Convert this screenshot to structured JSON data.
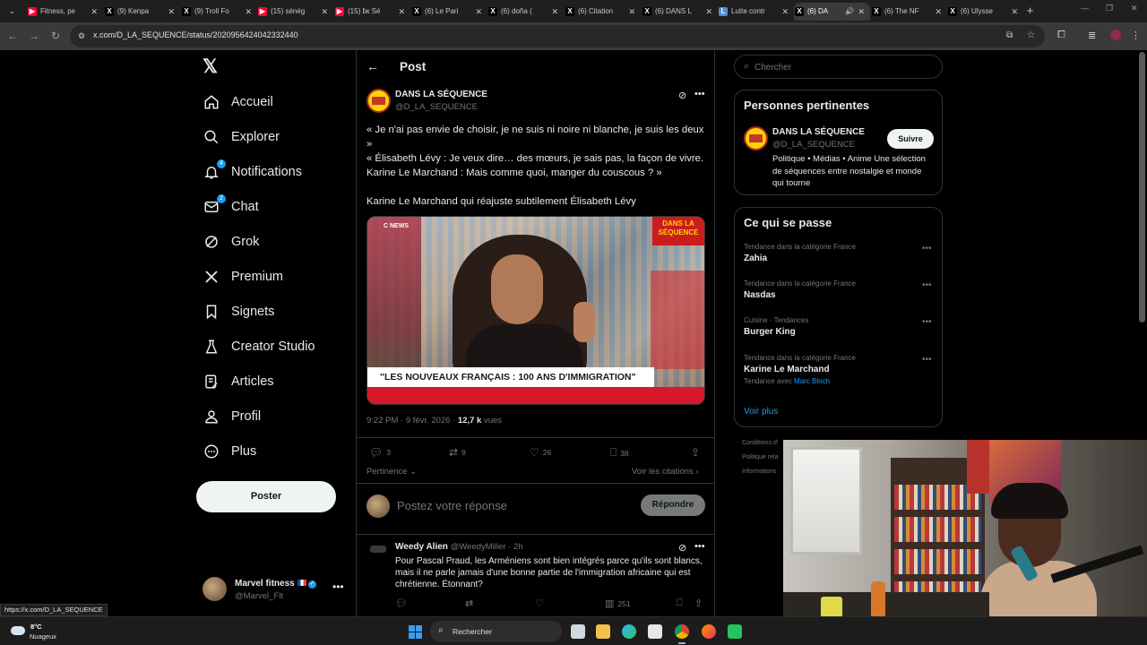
{
  "browser": {
    "tabs": [
      {
        "label": "Fitness, pe",
        "favicon": "youtube-icon"
      },
      {
        "label": "(9) Kenpa",
        "favicon": "x-icon"
      },
      {
        "label": "(9) Troll Fo",
        "favicon": "x-icon"
      },
      {
        "label": "(15) sénég",
        "favicon": "youtube-icon"
      },
      {
        "label": "(15) ɓк Sé",
        "favicon": "youtube-icon"
      },
      {
        "label": "(6) Le Pari",
        "favicon": "x-icon"
      },
      {
        "label": "(6) doña (",
        "favicon": "x-icon"
      },
      {
        "label": "(6) Citation",
        "favicon": "x-icon"
      },
      {
        "label": "(6) DANS L",
        "favicon": "x-icon"
      },
      {
        "label": "Lutte contr",
        "favicon": "document-icon"
      },
      {
        "label": "(6) DA",
        "favicon": "x-icon",
        "active": true
      },
      {
        "label": "(6) The NF",
        "favicon": "x-icon"
      },
      {
        "label": "(6) Ulysse",
        "favicon": "x-icon"
      }
    ],
    "url": "x.com/D_LA_SEQUENCE/status/2020956424042332440",
    "status_url": "https://x.com/D_LA_SEQUENCE"
  },
  "nav": {
    "items": [
      {
        "label": "Accueil",
        "icon": "home-icon"
      },
      {
        "label": "Explorer",
        "icon": "search-icon"
      },
      {
        "label": "Notifications",
        "icon": "bell-icon",
        "badge": "4"
      },
      {
        "label": "Chat",
        "icon": "mail-icon",
        "badge": "2"
      },
      {
        "label": "Grok",
        "icon": "grok-icon"
      },
      {
        "label": "Premium",
        "icon": "x-icon"
      },
      {
        "label": "Signets",
        "icon": "bookmark-icon"
      },
      {
        "label": "Creator Studio",
        "icon": "creator-studio-icon"
      },
      {
        "label": "Articles",
        "icon": "articles-icon"
      },
      {
        "label": "Profil",
        "icon": "person-icon"
      },
      {
        "label": "Plus",
        "icon": "more-circle-icon"
      }
    ],
    "post_button": "Poster",
    "account": {
      "name": "Marvel fitness",
      "handle": "@Marvel_Flt"
    }
  },
  "post": {
    "header": "Post",
    "author": {
      "name": "DANS LA SÉQUENCE",
      "handle": "@D_LA_SEQUENCE"
    },
    "text": [
      "« Je n'ai pas envie de choisir, je ne suis ni noire ni blanche, je suis les deux »",
      "« Élisabeth Lévy : Je veux dire… des mœurs, je sais pas, la façon de vivre.",
      "Karine Le Marchand : Mais comme quoi, manger du couscous ? »",
      "Karine Le Marchand qui réajuste subtilement Élisabeth Lévy"
    ],
    "media": {
      "chyron": "\"LES NOUVEAUX FRANÇAIS : 100 ANS D'IMMIGRATION\"",
      "channel": "C NEWS",
      "brand": "DANS LA SÉQUENCE"
    },
    "timestamp": "9:22 PM · 9 févr. 2026 · ",
    "views_count": "12,7 k",
    "views_label": " vues",
    "actions": {
      "replies": "3",
      "reposts": "9",
      "likes": "26",
      "bookmarks": "38"
    },
    "sort_label": "Pertinence",
    "quotes_label": "Voir les citations",
    "reply_placeholder": "Postez votre réponse",
    "reply_button": "Répondre"
  },
  "reply": {
    "name": "Weedy Alien",
    "handle": "@WeedyMiller",
    "time": "· 2h",
    "text": "Pour Pascal Praud, les Arméniens sont bien intégrés parce qu'ils sont blancs, mais il ne parle jamais d'une bonne partie de l'immigration africaine qui est chrétienne. Étonnant?",
    "views": "251"
  },
  "sidebar": {
    "search_placeholder": "Chercher",
    "relevant": {
      "title": "Personnes pertinentes",
      "name": "DANS LA SÉQUENCE",
      "handle": "@D_LA_SEQUENCE",
      "follow_label": "Suivre",
      "bio": "Politique • Médias • Anime Une sélection de séquences entre nostalgie et monde qui tourne"
    },
    "trends": {
      "title": "Ce qui se passe",
      "items": [
        {
          "context": "Tendance dans la catégorie France",
          "name": "Zahia"
        },
        {
          "context": "Tendance dans la catégorie France",
          "name": "Nasdas"
        },
        {
          "context": "Cuisine · Tendances",
          "name": "Burger King"
        },
        {
          "context": "Tendance dans la catégorie France",
          "name": "Karine Le Marchand",
          "with_label": "Tendance avec ",
          "with_value": "Marc Bloch"
        }
      ],
      "see_more": "Voir plus"
    },
    "footer": [
      "Conditions d'",
      "Politique rela",
      "Informations"
    ]
  },
  "taskbar": {
    "weather_temp": "8°C",
    "weather_cond": "Nuageux",
    "search_label": "Rechercher"
  },
  "colors": {
    "accent": "#1d9bf0",
    "background": "#000000",
    "border": "#2f3336",
    "secondary_text": "#71767b"
  }
}
